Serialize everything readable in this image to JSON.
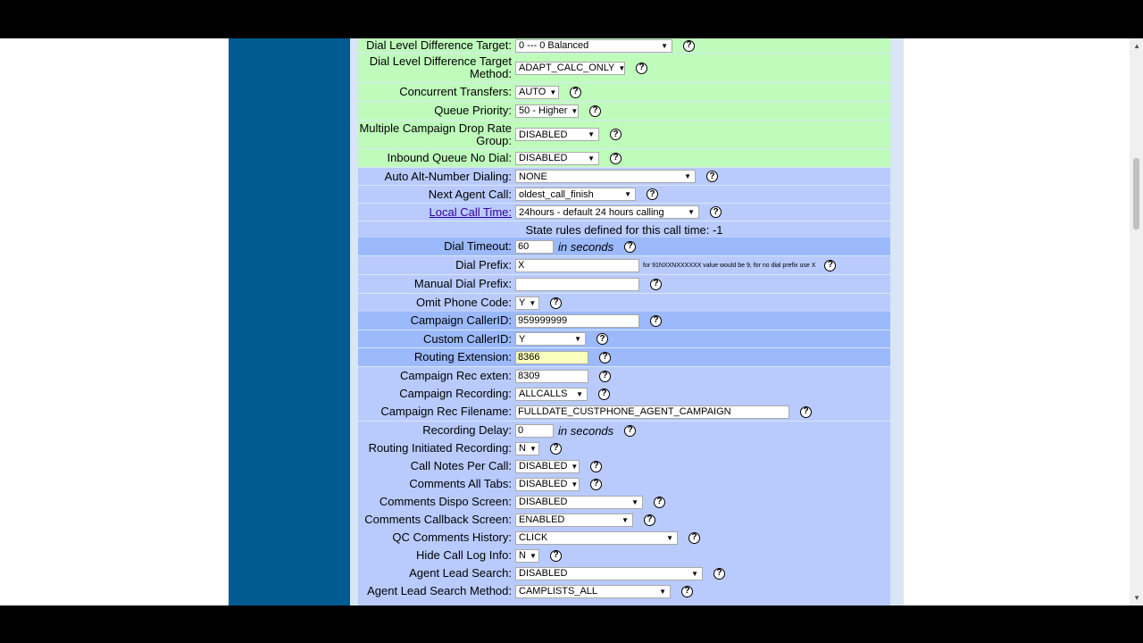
{
  "rows": [
    {
      "label": "Dial Level Difference Target:",
      "kind": "select",
      "value": "0 --- 0 Balanced"
    },
    {
      "label": "Dial Level Difference Target Method:",
      "kind": "select",
      "value": "ADAPT_CALC_ONLY"
    },
    {
      "label": "Concurrent Transfers:",
      "kind": "select",
      "value": "AUTO"
    },
    {
      "label": "Queue Priority:",
      "kind": "select",
      "value": "50 - Higher"
    },
    {
      "label": "Multiple Campaign Drop Rate Group:",
      "kind": "select",
      "value": "DISABLED"
    },
    {
      "label": "Inbound Queue No Dial:",
      "kind": "select",
      "value": "DISABLED"
    },
    {
      "label": "Auto Alt-Number Dialing:",
      "kind": "select",
      "value": "NONE"
    },
    {
      "label": "Next Agent Call:",
      "kind": "select",
      "value": "oldest_call_finish"
    },
    {
      "label": "Local Call Time:",
      "kind": "select",
      "value": "24hours - default 24 hours calling",
      "link": true
    },
    {
      "note": "State rules defined for this call time: -1"
    },
    {
      "label": "Dial Timeout:",
      "kind": "input",
      "value": "60",
      "unit": "in seconds"
    },
    {
      "label": "Dial Prefix:",
      "kind": "input",
      "value": "X",
      "tiny": "for 91NXXNXXXXXX value would be 9, for no dial prefix use X"
    },
    {
      "label": "Manual Dial Prefix:",
      "kind": "input",
      "value": ""
    },
    {
      "label": "Omit Phone Code:",
      "kind": "select",
      "value": "Y"
    },
    {
      "label": "Campaign CallerID:",
      "kind": "input",
      "value": "959999999"
    },
    {
      "label": "Custom CallerID:",
      "kind": "select",
      "value": "Y"
    },
    {
      "label": "Routing Extension:",
      "kind": "input",
      "value": "8366",
      "highlight": true
    },
    {
      "label": "Campaign Rec exten:",
      "kind": "input",
      "value": "8309"
    },
    {
      "label": "Campaign Recording:",
      "kind": "select",
      "value": "ALLCALLS"
    },
    {
      "label": "Campaign Rec Filename:",
      "kind": "input",
      "value": "FULLDATE_CUSTPHONE_AGENT_CAMPAIGN"
    },
    {
      "label": "Recording Delay:",
      "kind": "input",
      "value": "0",
      "unit": "in seconds"
    },
    {
      "label": "Routing Initiated Recording:",
      "kind": "select",
      "value": "N"
    },
    {
      "label": "Call Notes Per Call:",
      "kind": "select",
      "value": "DISABLED"
    },
    {
      "label": "Comments All Tabs:",
      "kind": "select",
      "value": "DISABLED"
    },
    {
      "label": "Comments Dispo Screen:",
      "kind": "select",
      "value": "DISABLED"
    },
    {
      "label": "Comments Callback Screen:",
      "kind": "select",
      "value": "ENABLED"
    },
    {
      "label": "QC Comments History:",
      "kind": "select",
      "value": "CLICK"
    },
    {
      "label": "Hide Call Log Info:",
      "kind": "select",
      "value": "N"
    },
    {
      "label": "Agent Lead Search:",
      "kind": "select",
      "value": "DISABLED"
    },
    {
      "label": "Agent Lead Search Method:",
      "kind": "select",
      "value": "CAMPLISTS_ALL"
    }
  ],
  "help_glyph": "?",
  "select_arrow": "▼",
  "colors": {
    "green_row": "#BFFCBC",
    "light_row": "#B9CBFD",
    "dark_row": "#9BB9FB",
    "nav": "#015B91",
    "link": "#330099"
  }
}
